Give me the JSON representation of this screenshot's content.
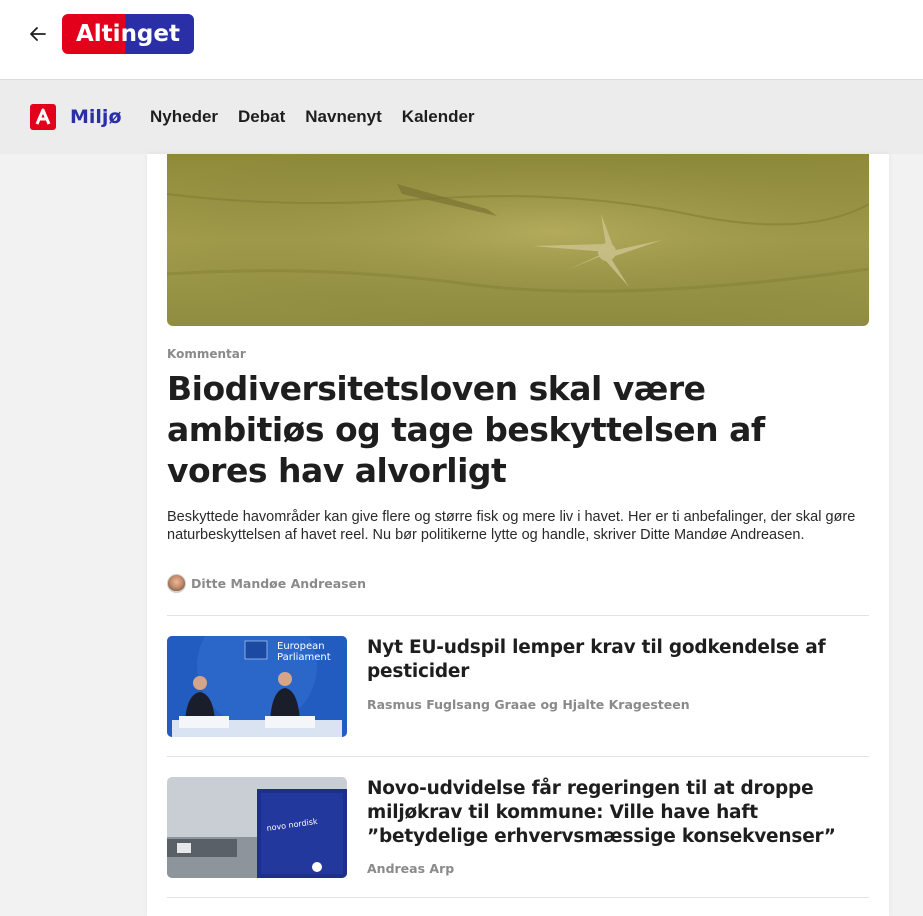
{
  "header": {
    "back_label": "←",
    "logo_text": "Altinget"
  },
  "nav": {
    "section_logo": "A",
    "section": "Miljø",
    "links": [
      "Nyheder",
      "Debat",
      "Navnenyt",
      "Kalender"
    ]
  },
  "article": {
    "kicker": "Kommentar",
    "title": "Biodiversitetsloven skal være ambitiøs og tage beskyttelsen af vores hav alvorligt",
    "lead": "Beskyttede havområder kan give flere og større fisk og mere liv i havet. Her er ti anbefalinger, der skal gøre naturbeskyttelsen af havet reel. Nu bør politikerne lytte og handle, skriver Ditte Mandøe Andreasen.",
    "author": "Ditte Mandøe Andreasen"
  },
  "stories": [
    {
      "title": "Nyt EU-udspil lemper krav til godkendelse af pesticider",
      "authors": "Rasmus Fuglsang Graae og Hjalte Kragesteen",
      "thumb_text_1": "European",
      "thumb_text_2": "Parliament"
    },
    {
      "title": "Novo-udvidelse får regeringen til at droppe miljøkrav til kommune: Ville have haft ”betydelige erhvervsmæssige konsekvenser”",
      "authors": "Andreas Arp",
      "thumb_text_1": "novo nordisk"
    }
  ],
  "colors": {
    "brand_red": "#e3001b",
    "brand_blue": "#2a2fa8"
  }
}
